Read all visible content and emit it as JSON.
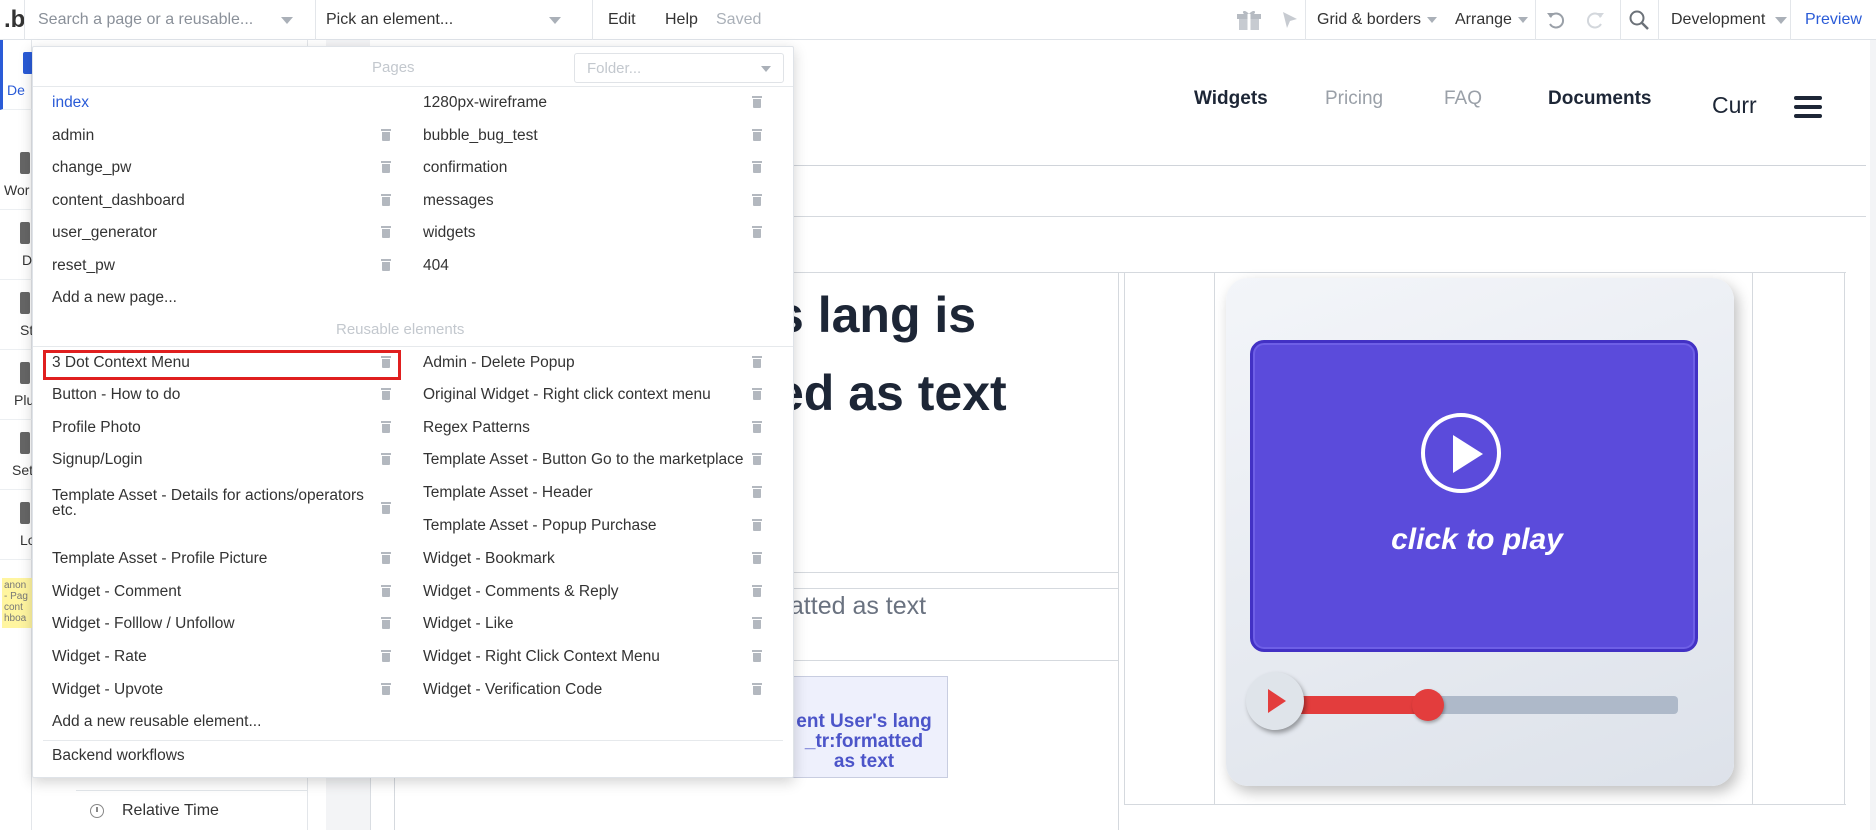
{
  "topbar": {
    "logo": ".b",
    "search_placeholder": "Search a page or a reusable...",
    "element_picker": "Pick an element...",
    "edit": "Edit",
    "help": "Help",
    "saved": "Saved",
    "grid_borders": "Grid & borders",
    "arrange": "Arrange",
    "environment": "Development",
    "preview": "Preview"
  },
  "sidebar": {
    "items": [
      {
        "label": "De"
      },
      {
        "label": "Wor"
      },
      {
        "label": "D"
      },
      {
        "label": "St"
      },
      {
        "label": "Plu"
      },
      {
        "label": "Set"
      },
      {
        "label": "Lo"
      }
    ],
    "note": "anon - Pag cont hboa"
  },
  "dropdown": {
    "pages_title": "Pages",
    "folder_placeholder": "Folder...",
    "pages_left": [
      "index",
      "admin",
      "change_pw",
      "content_dashboard",
      "user_generator",
      "reset_pw"
    ],
    "pages_right": [
      "1280px-wireframe",
      "bubble_bug_test",
      "confirmation",
      "messages",
      "widgets",
      "404"
    ],
    "add_page": "Add a new page...",
    "reusable_title": "Reusable elements",
    "reusable_left": [
      "3 Dot Context Menu",
      "Button - How to do",
      "Profile Photo",
      "Signup/Login",
      "Template Asset - Details for actions/operators etc.",
      "Template Asset - Profile Picture",
      "Widget - Comment",
      "Widget - Folllow / Unfollow",
      "Widget - Rate",
      "Widget - Upvote"
    ],
    "reusable_right": [
      "Admin - Delete Popup",
      "Original Widget - Right click context menu",
      "Regex Patterns",
      "Template Asset - Button Go to the marketplace",
      "Template Asset - Header",
      "Template Asset - Popup Purchase",
      "Widget - Bookmark",
      "Widget - Comments & Reply",
      "Widget - Like",
      "Widget - Right Click Context Menu",
      "Widget - Verification Code"
    ],
    "add_reusable": "Add a new reusable element...",
    "backend": "Backend workflows"
  },
  "panel": {
    "relative_time": "Relative Time"
  },
  "canvas": {
    "nav": [
      "Widgets",
      "Pricing",
      "FAQ",
      "Documents",
      "Curr"
    ],
    "heading_line1": "s lang is",
    "heading_line2": "ed as text",
    "subtext": "natted as text",
    "lang_box_lines": [
      "ent User's lang",
      "_tr:formatted",
      "as text"
    ],
    "video_caption": "click to play",
    "video_progress": 0.38
  },
  "colors": {
    "accent": "#2a5bd7",
    "highlight": "#e01f1f",
    "video_screen": "#5b4bdb",
    "progress": "#e33d3d"
  }
}
